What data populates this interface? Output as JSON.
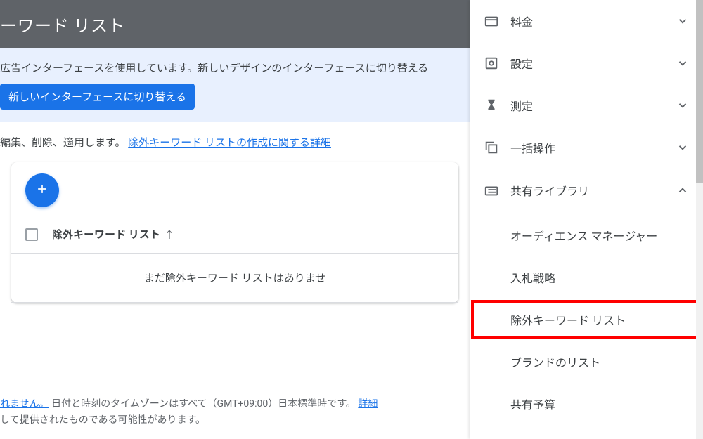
{
  "page": {
    "title": "ーワード リスト"
  },
  "notice": {
    "text": "広告インターフェースを使用しています。新しいデザインのインターフェースに切り替える",
    "button": "新しいインターフェースに切り替える"
  },
  "intro": {
    "text": "編集、削除、適用します。 ",
    "link": "除外キーワード リストの作成に関する詳細"
  },
  "table": {
    "column_label": "除外キーワード リスト",
    "sort_arrow": "↑",
    "empty_message": "まだ除外キーワード リストはありませ"
  },
  "footer": {
    "line1_link": "れません。",
    "line1_rest": " 日付と時刻のタイムゾーンはすべて（GMT+09:00）日本標準時です。 ",
    "line1_more": "詳細",
    "line2": "して提供されたものである可能性があります。"
  },
  "sidebar": {
    "items": [
      {
        "label": "料金"
      },
      {
        "label": "設定"
      },
      {
        "label": "測定"
      },
      {
        "label": "一括操作"
      },
      {
        "label": "共有ライブラリ",
        "expanded": true
      }
    ],
    "sub": [
      {
        "label": "オーディエンス マネージャー"
      },
      {
        "label": "入札戦略"
      },
      {
        "label": "除外キーワード リスト",
        "highlighted": true
      },
      {
        "label": "ブランドのリスト"
      },
      {
        "label": "共有予算"
      }
    ]
  }
}
